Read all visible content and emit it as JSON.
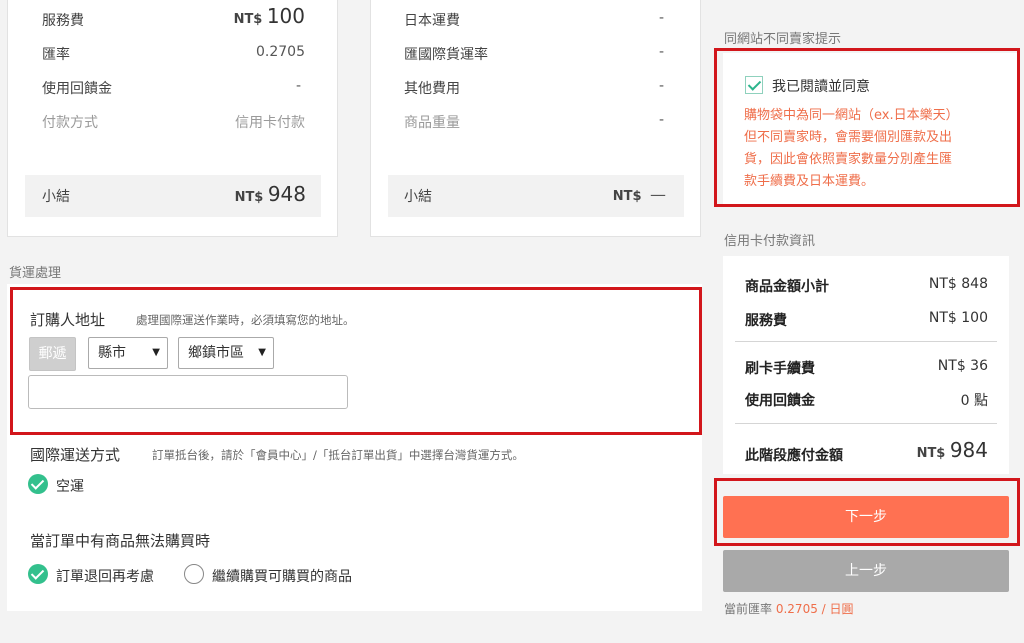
{
  "left_card": {
    "service_fee_label": "服務費",
    "service_fee_currency": "NT$",
    "service_fee_value": "100",
    "rate_label": "匯率",
    "rate_value": "0.2705",
    "rebate_label": "使用回饋金",
    "rebate_value": "-",
    "payment_method_label": "付款方式",
    "payment_method_value": "信用卡付款",
    "subtotal_label": "小結",
    "subtotal_currency": "NT$",
    "subtotal_value": "948"
  },
  "right_card": {
    "jp_shipping_label": "日本運費",
    "jp_shipping_value": "-",
    "intl_shipping_label": "匯國際貨運率",
    "intl_shipping_value": "-",
    "other_fees_label": "其他費用",
    "other_fees_value": "-",
    "weight_label": "商品重量",
    "weight_value": "-",
    "subtotal_label": "小結",
    "subtotal_currency": "NT$",
    "subtotal_value": "—"
  },
  "shipping": {
    "section_title": "貨運處理",
    "address_label": "訂購人地址",
    "address_hint": "處理國際運送作業時，必須填寫您的地址。",
    "postal_button": "郵遞",
    "county_select": "縣市",
    "district_select": "鄉鎮市區",
    "street_value": "",
    "method_label": "國際運送方式",
    "method_hint": "訂單抵台後，請於「會員中心」/「抵台訂單出貨」中選擇台灣貨運方式。",
    "method_option": "空運",
    "unavailable_label": "當訂單中有商品無法購買時",
    "option_return": "訂單退回再考慮",
    "option_continue": "繼續購買可購買的商品"
  },
  "notice": {
    "title": "同網站不同賣家提示",
    "agree_label": "我已閱讀並同意",
    "text_lines": [
      "購物袋中為同一網站（ex.日本樂天）",
      "但不同賣家時，會需要個別匯款及出",
      "貨，因此會依照賣家數量分別產生匯",
      "款手續費及日本運費。"
    ]
  },
  "payment": {
    "title": "信用卡付款資訊",
    "item_subtotal_label": "商品金額小計",
    "item_subtotal_value": "NT$ 848",
    "service_fee_label": "服務費",
    "service_fee_value": "NT$ 100",
    "card_fee_label": "刷卡手續費",
    "card_fee_value": "NT$ 36",
    "rebate_label": "使用回饋金",
    "rebate_value": "0 點",
    "total_label": "此階段應付金額",
    "total_currency": "NT$",
    "total_value": "984",
    "next_button": "下一步",
    "prev_button": "上一步",
    "rate_prefix": "當前匯率",
    "rate_value": "0.2705 / 日圓"
  },
  "colors": {
    "accent_orange": "#ff7152",
    "notice_red": "#ef6e4a",
    "highlight_box": "#d2161b",
    "check_green": "#33c08d"
  }
}
